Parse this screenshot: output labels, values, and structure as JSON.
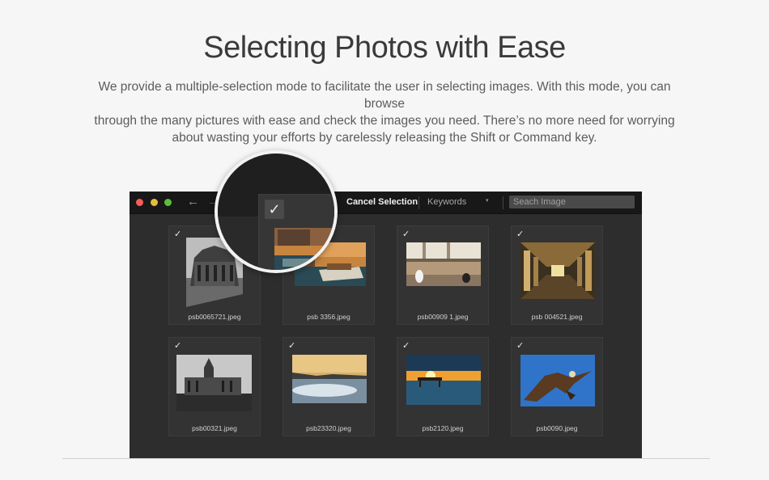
{
  "heading": {
    "title": "Selecting Photos with Ease",
    "line1": "We provide a multiple-selection mode to facilitate the user in selecting images. With this mode, you can browse",
    "line2": "through the many pictures with ease and check the images you need. There’s no more need for worrying",
    "line3": "about wasting your efforts by carelessly releasing the Shift or Command key."
  },
  "toolbar": {
    "back_icon": "←",
    "forward_icon": "→",
    "cancel_label": "Cancel Selection",
    "keywords_label": "Keywords",
    "keywords_caret": "▾",
    "search_placeholder": "Seach Image"
  },
  "check_glyph": "✓",
  "photos": [
    {
      "file": "psb0065721.jpeg",
      "checked": true
    },
    {
      "file": "psb 3356.jpeg",
      "checked": true
    },
    {
      "file": "psb00909 1.jpeg",
      "checked": true
    },
    {
      "file": "psb 004521.jpeg",
      "checked": true
    },
    {
      "file": "psb00321.jpeg",
      "checked": true
    },
    {
      "file": "psb23320.jpeg",
      "checked": true
    },
    {
      "file": "psb2120.jpeg",
      "checked": true
    },
    {
      "file": "psb0090.jpeg",
      "checked": true
    }
  ],
  "colors": {
    "window_bg": "#2d2d2d",
    "toolbar_bg": "#181818",
    "traffic_red": "#fc5b57",
    "traffic_yellow": "#e5bf3c",
    "traffic_green": "#57c038"
  }
}
